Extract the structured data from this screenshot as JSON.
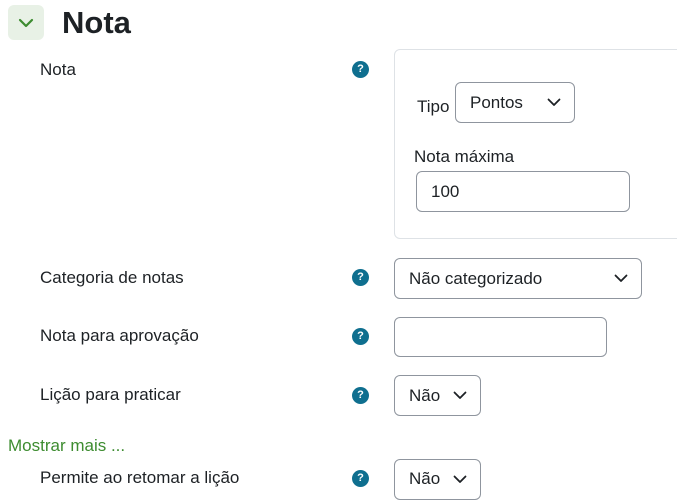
{
  "section": {
    "title": "Nota",
    "toggle_icon": "chevron-down-icon",
    "accent_color": "#3d8c30"
  },
  "fields": {
    "nota": {
      "label": "Nota"
    },
    "tipo": {
      "label": "Tipo",
      "value": "Pontos"
    },
    "nota_maxima": {
      "label": "Nota máxima",
      "value": "100"
    },
    "categoria": {
      "label": "Categoria de notas",
      "value": "Não categorizado"
    },
    "aprovacao": {
      "label": "Nota para aprovação",
      "value": ""
    },
    "licao_praticar": {
      "label": "Lição para praticar",
      "value": "Não"
    },
    "permite_retomar": {
      "label": "Permite ao retomar a lição",
      "value": "Não"
    }
  },
  "help_icon": {
    "glyph": "?",
    "color": "#0f6f8f"
  },
  "show_more": {
    "label": "Mostrar mais ..."
  }
}
